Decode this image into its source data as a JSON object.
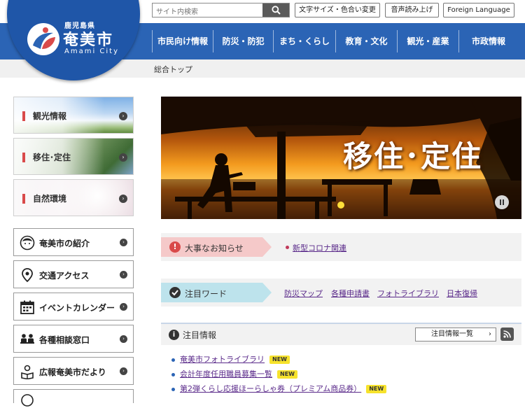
{
  "header": {
    "prefecture": "鹿児島県",
    "city_name": "奄美市",
    "city_name_en": "Amami City",
    "search": {
      "placeholder": "サイト内検索"
    },
    "utility_buttons": {
      "text_color": "文字サイズ・色合い変更",
      "read_aloud": "音声読み上げ",
      "foreign_language": "Foreign Language"
    }
  },
  "nav": {
    "items": [
      "市民向け情報",
      "防災・防犯",
      "まち・くらし",
      "教育・文化",
      "観光・産業",
      "市政情報"
    ]
  },
  "breadcrumb": {
    "home": "総合トップ"
  },
  "sidebar": {
    "tiles": [
      {
        "label": "観光情報"
      },
      {
        "label": "移住･定住"
      },
      {
        "label": "自然環境"
      }
    ],
    "menu": [
      {
        "label": "奄美市の紹介",
        "icon": "face-icon"
      },
      {
        "label": "交通アクセス",
        "icon": "location-pin-icon"
      },
      {
        "label": "イベントカレンダー",
        "icon": "calendar-icon"
      },
      {
        "label": "各種相談窓口",
        "icon": "consultation-icon"
      },
      {
        "label": "広報奄美市だより",
        "icon": "reader-icon"
      }
    ]
  },
  "hero": {
    "title": "移住･定住"
  },
  "notices": {
    "important": {
      "label": "大事なお知らせ",
      "links": [
        "新型コロナ関連"
      ]
    },
    "keywords": {
      "label": "注目ワード",
      "links": [
        "防災マップ",
        "各種申請書",
        "フォトライブラリ",
        "日本復帰"
      ]
    }
  },
  "featured": {
    "title": "注目情報",
    "list_button": "注目情報一覧",
    "items": [
      {
        "text": "奄美市フォトライブラリ",
        "badge": "NEW"
      },
      {
        "text": "会計年度任用職員募集一覧",
        "badge": "NEW"
      },
      {
        "text": "第2弾くらし応援ほーらしゃ券（プレミアム商品券）",
        "badge": "NEW"
      }
    ]
  },
  "colors": {
    "nav_blue": "#2b64b5",
    "logo_blue": "#1f56a8",
    "important_pink": "#f5c9c9",
    "keyword_blue": "#bde3ec",
    "link_purple": "#5a2a8a",
    "badge_yellow": "#f6e22c"
  }
}
